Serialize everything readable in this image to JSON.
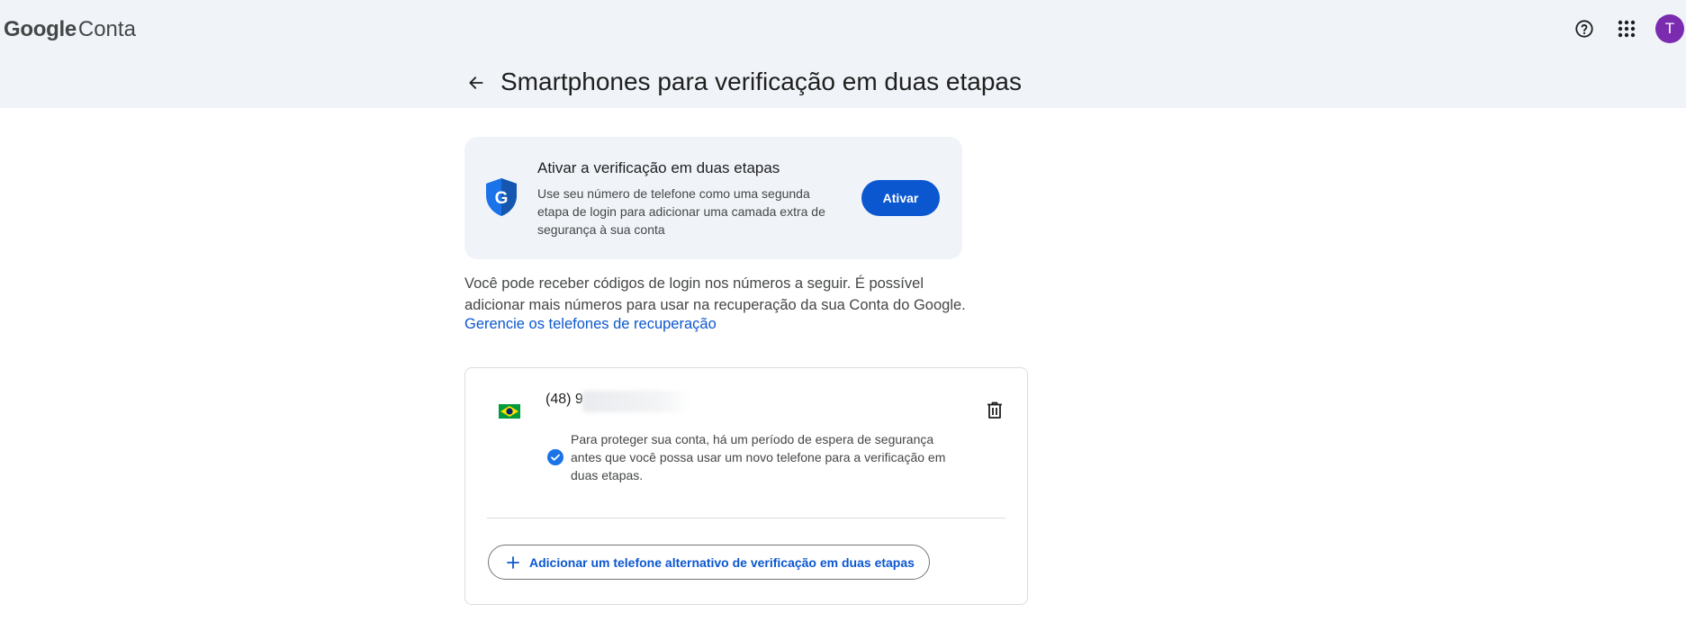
{
  "header": {
    "logo_google": "Google",
    "logo_product": "Conta",
    "avatar_letter": "T",
    "icons": [
      "help-icon",
      "apps-grid-icon"
    ]
  },
  "page": {
    "title": "Smartphones para verificação em duas etapas"
  },
  "promo": {
    "title": "Ativar a verificação em duas etapas",
    "description": "Use seu número de telefone como uma segunda etapa de login para adicionar uma camada extra de segurança à sua conta",
    "button_label": "Ativar",
    "icon": "google-shield-icon"
  },
  "info": {
    "text": "Você pode receber códigos de login nos números a seguir. É possível adicionar mais números para usar na recuperação da sua Conta do Google.",
    "link": "Gerencie os telefones de recuperação"
  },
  "phone_card": {
    "country_flag": "brazil-flag-icon",
    "phone_visible": "(48) 9",
    "note": "Para proteger sua conta, há um período de espera de segurança antes que você possa usar um novo telefone para a verificação em duas etapas.",
    "add_button_label": "Adicionar um telefone alternativo de verificação em duas etapas"
  },
  "colors": {
    "accent": "#0b57d0",
    "header_bg": "#f0f4f9",
    "avatar_bg": "#7b2bb0"
  }
}
